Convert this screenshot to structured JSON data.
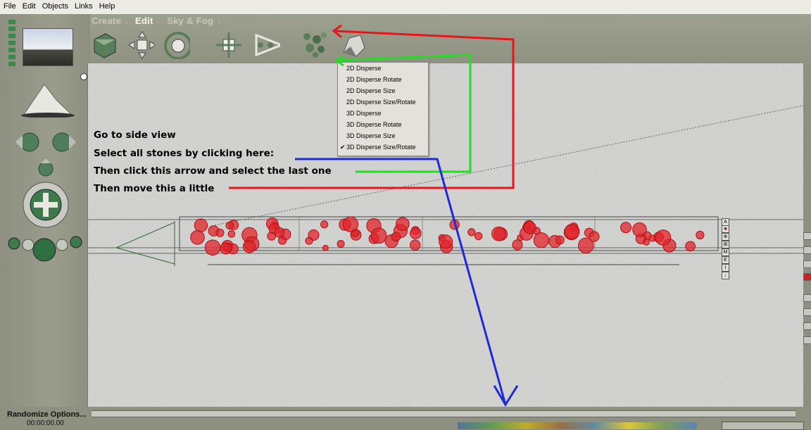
{
  "menu": {
    "items": [
      "File",
      "Edit",
      "Objects",
      "Links",
      "Help"
    ]
  },
  "tabs": {
    "create": "Create",
    "edit": "Edit",
    "sky": "Sky & Fog",
    "separator": "›"
  },
  "dropdown": {
    "items": [
      {
        "label": "2D Disperse",
        "checked": false
      },
      {
        "label": "2D Disperse Rotate",
        "checked": false
      },
      {
        "label": "2D Disperse Size",
        "checked": false
      },
      {
        "label": "2D Disperse Size/Rotate",
        "checked": false
      },
      {
        "label": "3D Disperse",
        "checked": false
      },
      {
        "label": "3D Disperse Rotate",
        "checked": false
      },
      {
        "label": "3D Disperse Size",
        "checked": false
      },
      {
        "label": "3D Disperse Size/Rotate",
        "checked": true
      }
    ],
    "check_mark": "✔"
  },
  "instructions": {
    "line1": "Go to side view",
    "line2": "Select all stones by clicking here:",
    "line3": "Then click this arrow and select the last one",
    "line4": "Then move this a little"
  },
  "status": {
    "label": "Randomize Options...",
    "time": "00:00:00.00"
  },
  "viewport_buttons": [
    "A",
    "■",
    "⊕",
    "⊞",
    "M",
    "E",
    "I",
    "↓"
  ],
  "colors": {
    "arrow_red": "#e8151b",
    "arrow_green": "#22dd22",
    "arrow_blue": "#1e2ad8",
    "stone_red": "#e0242a",
    "ui_olive": "#8d8f80",
    "viewport_bg": "#d3d3d1"
  },
  "icons": [
    "cube-icon",
    "move-icon",
    "rotate-icon",
    "scale-icon",
    "link-icon",
    "disperse-icon",
    "rock-icon",
    "sky-preview-icon",
    "mountain-icon",
    "camera-move-icon",
    "trackball-icon",
    "sphere-icon"
  ]
}
